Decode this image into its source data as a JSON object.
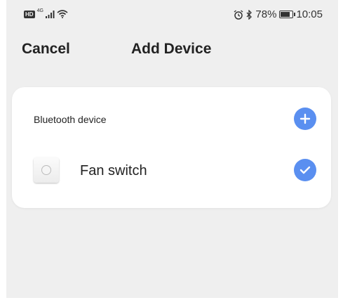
{
  "status_bar": {
    "hd": "HD",
    "network": "4G",
    "battery_text": "78%",
    "battery_level": 0.78,
    "time": "10:05",
    "icons": [
      "signal-icon",
      "wifi-icon",
      "alarm-icon",
      "bluetooth-icon",
      "battery-icon"
    ]
  },
  "header": {
    "cancel_label": "Cancel",
    "title": "Add Device"
  },
  "card": {
    "section_label": "Bluetooth device",
    "add_icon": "plus-icon",
    "devices": [
      {
        "name": "Fan switch",
        "selected": true,
        "icon": "device-knob-icon"
      }
    ]
  },
  "colors": {
    "accent": "#5a8ff0",
    "background": "#efefef",
    "card": "#ffffff",
    "text": "#222222"
  }
}
